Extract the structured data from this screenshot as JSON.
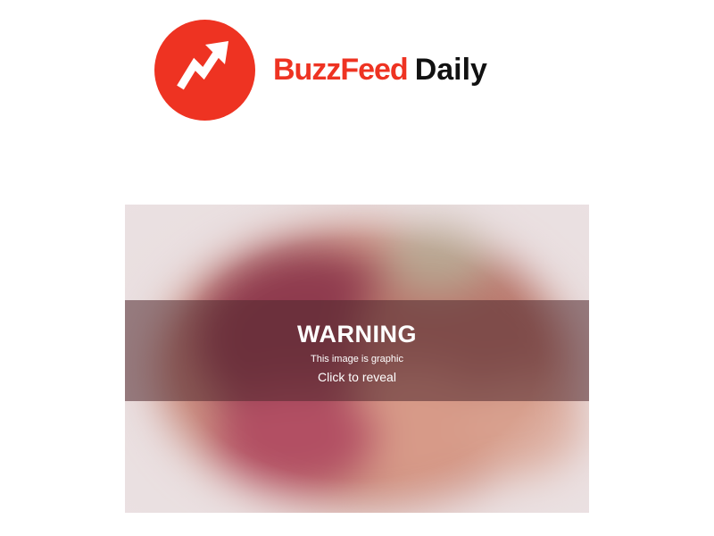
{
  "header": {
    "logo_icon": "trending-arrow-icon",
    "brand_name": "BuzzFeed",
    "brand_suffix": "Daily"
  },
  "graphic_image": {
    "warning_title": "WARNING",
    "warning_subtitle": "This image is graphic",
    "reveal_label": "Click to reveal"
  },
  "colors": {
    "brand_red": "#ee3322",
    "text_dark": "#111111",
    "overlay": "#50282d"
  }
}
